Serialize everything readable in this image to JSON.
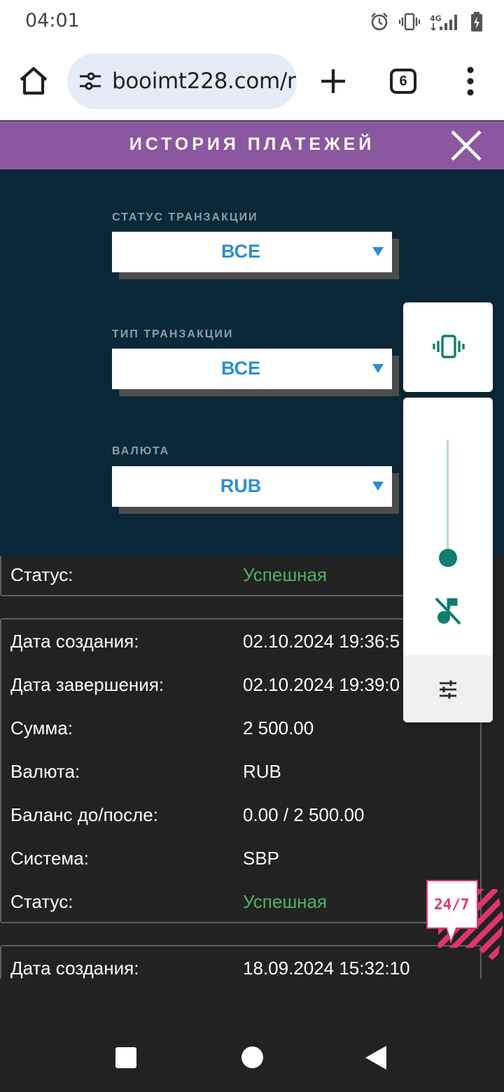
{
  "status_bar": {
    "time": "04:01",
    "icons": [
      "alarm-icon",
      "vibrate-icon",
      "network-4g-icon",
      "signal-icon",
      "battery-charging-icon"
    ],
    "network_label": "4G"
  },
  "browser": {
    "url": "booimt228.com/r",
    "tab_count": "6",
    "icons": [
      "home-icon",
      "site-settings-icon",
      "new-tab-icon",
      "tab-switcher-icon",
      "overflow-menu-icon"
    ]
  },
  "modal": {
    "title": "ИСТОРИЯ ПЛАТЕЖЕЙ",
    "accent_color": "#8b57a0"
  },
  "filters": {
    "status": {
      "label": "СТАТУС ТРАНЗАКЦИИ",
      "value": "ВСЕ"
    },
    "type": {
      "label": "ТИП ТРАНЗАКЦИИ",
      "value": "ВСЕ"
    },
    "currency": {
      "label": "ВАЛЮТА",
      "value": "RUB"
    },
    "value_color": "#2d8ed3"
  },
  "transactions": {
    "partial_top": {
      "status_label": "Статус:",
      "status_value": "Успешная"
    },
    "card1": {
      "created_label": "Дата создания:",
      "created_value": "02.10.2024 19:36:5",
      "completed_label": "Дата завершения:",
      "completed_value": "02.10.2024 19:39:0",
      "amount_label": "Сумма:",
      "amount_value": "2 500.00",
      "currency_label": "Валюта:",
      "currency_value": "RUB",
      "balance_label": "Баланс до/после:",
      "balance_value": "0.00 / 2 500.00",
      "system_label": "Система:",
      "system_value": "SBP",
      "status_label": "Статус:",
      "status_value": "Успешная"
    },
    "card2": {
      "created_label": "Дата создания:",
      "created_value": "18.09.2024 15:32:10"
    },
    "success_color": "#4fb365"
  },
  "volume_overlay": {
    "level": 0,
    "icons": [
      "vibrate-mode-icon",
      "media-muted-icon",
      "sound-settings-icon"
    ],
    "accent_color": "#107d6f"
  },
  "chat_badge": {
    "text": "24/7",
    "color": "#e0356b"
  },
  "nav": {
    "icons": [
      "recents-icon",
      "home-circle-icon",
      "back-icon"
    ]
  }
}
